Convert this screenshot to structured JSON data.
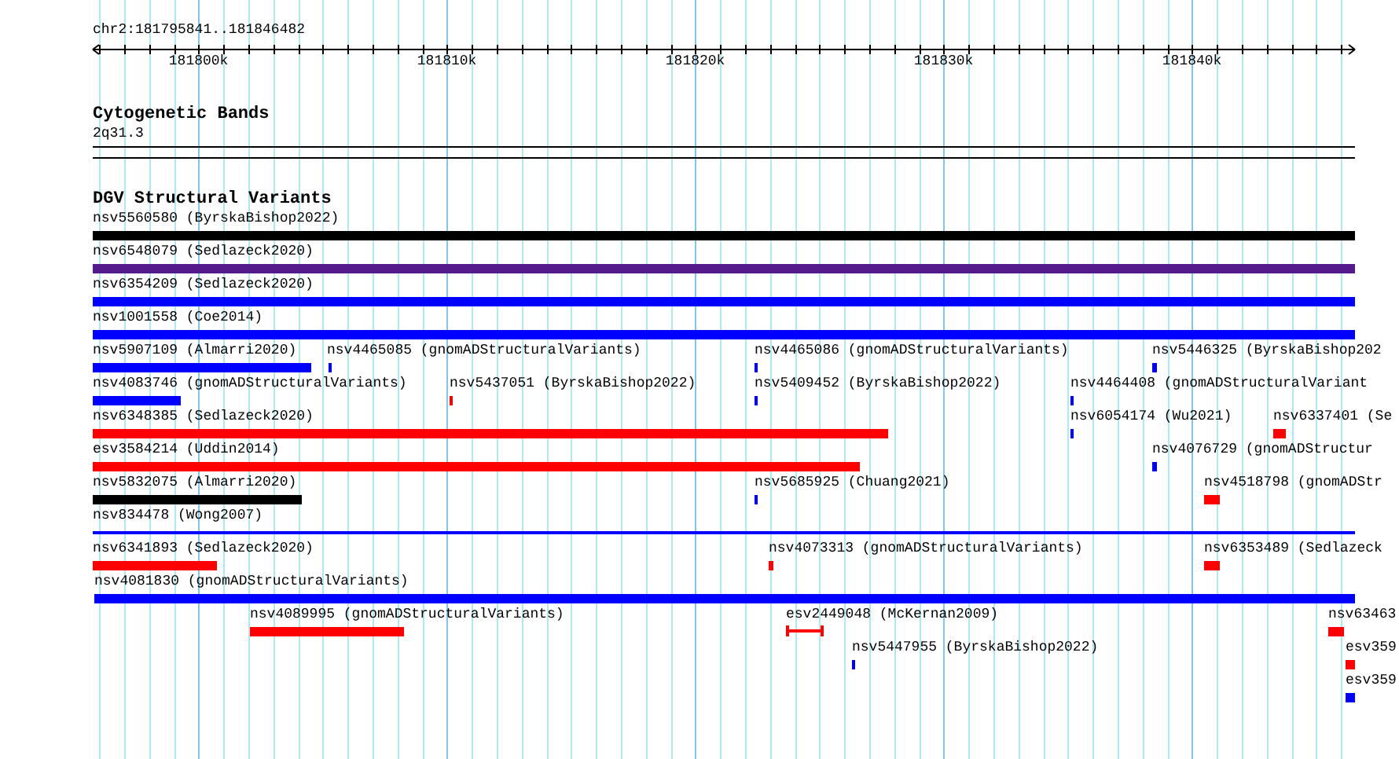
{
  "ruler": {
    "position": "chr2:181795841..181846482",
    "ticks": [
      "181800k",
      "181810k",
      "181820k",
      "181830k",
      "181840k"
    ]
  },
  "tracks": [
    {
      "kind": "bands",
      "title": "Cytogenetic Bands",
      "bands": [
        {
          "label": "2q31.3"
        }
      ]
    },
    {
      "kind": "features",
      "title": "DGV Structural Variants",
      "features": [
        {
          "label": "nsv5560580 (ByrskaBishop2022)",
          "color": "#000000",
          "kind": "bar"
        },
        {
          "label": "nsv6548079 (Sedlazeck2020)",
          "color": "#551a8b",
          "kind": "bar"
        },
        {
          "label": "nsv6354209 (Sedlazeck2020)",
          "color": "#0000ff",
          "kind": "bar"
        },
        {
          "label": "nsv1001558 (Coe2014)",
          "color": "#0000ff",
          "kind": "bar"
        },
        {
          "label": "nsv5907109 (Almarri2020)",
          "color": "#0000ff",
          "kind": "bar"
        },
        {
          "label": "nsv4465085 (gnomADStructuralVariants)",
          "color": "#0000ff",
          "kind": "bar"
        },
        {
          "label": "nsv4465086 (gnomADStructuralVariants)",
          "color": "#0000ff",
          "kind": "bar"
        },
        {
          "label": "nsv5446325 (ByrskaBishop202",
          "color": "#0000ff",
          "kind": "bar"
        },
        {
          "label": "nsv4083746 (gnomADStructuralVariants)",
          "color": "#0000ff",
          "kind": "bar"
        },
        {
          "label": "nsv5437051 (ByrskaBishop2022)",
          "color": "#ff0000",
          "kind": "bar"
        },
        {
          "label": "nsv5409452 (ByrskaBishop2022)",
          "color": "#0000ff",
          "kind": "bar"
        },
        {
          "label": "nsv4464408 (gnomADStructuralVariant",
          "color": "#0000ff",
          "kind": "bar"
        },
        {
          "label": "nsv6348385 (Sedlazeck2020)",
          "color": "#ff0000",
          "kind": "bar"
        },
        {
          "label": "nsv6054174 (Wu2021)",
          "color": "#0000ff",
          "kind": "bar"
        },
        {
          "label": "nsv6337401 (Se",
          "color": "#ff0000",
          "kind": "bar"
        },
        {
          "label": "esv3584214 (Uddin2014)",
          "color": "#ff0000",
          "kind": "bar"
        },
        {
          "label": "nsv4076729 (gnomADStructur",
          "color": "#0000ff",
          "kind": "bar"
        },
        {
          "label": "nsv5832075 (Almarri2020)",
          "color": "#000000",
          "kind": "bar"
        },
        {
          "label": "nsv5685925 (Chuang2021)",
          "color": "#0000ff",
          "kind": "bar"
        },
        {
          "label": "nsv4518798 (gnomADStr",
          "color": "#ff0000",
          "kind": "bar"
        },
        {
          "label": "nsv834478 (Wong2007)",
          "color": "#0000ff",
          "kind": "line"
        },
        {
          "label": "nsv6341893 (Sedlazeck2020)",
          "color": "#ff0000",
          "kind": "bar"
        },
        {
          "label": "nsv4073313 (gnomADStructuralVariants)",
          "color": "#ff0000",
          "kind": "bar"
        },
        {
          "label": "nsv6353489 (Sedlazeck",
          "color": "#ff0000",
          "kind": "bar"
        },
        {
          "label": "nsv4081830 (gnomADStructuralVariants)",
          "color": "#0000ff",
          "kind": "bar"
        },
        {
          "label": "nsv4089995 (gnomADStructuralVariants)",
          "color": "#ff0000",
          "kind": "bar"
        },
        {
          "label": "esv2449048 (McKernan2009)",
          "color": "#ff0000",
          "kind": "interval"
        },
        {
          "label": "nsv63463",
          "color": "#ff0000",
          "kind": "bar"
        },
        {
          "label": "nsv5447955 (ByrskaBishop2022)",
          "color": "#0000ff",
          "kind": "bar"
        },
        {
          "label": "esv359",
          "color": "#ff0000",
          "kind": "bar"
        },
        {
          "label": "esv359",
          "color": "#0000ff",
          "kind": "bar"
        }
      ]
    }
  ]
}
